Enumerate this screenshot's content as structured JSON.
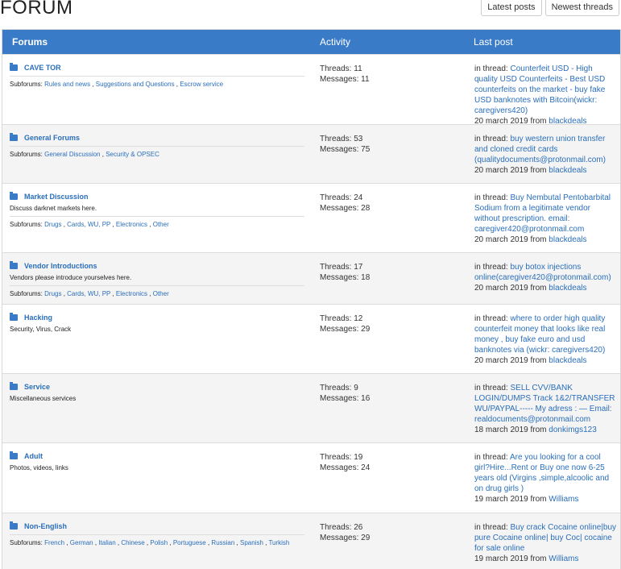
{
  "page_title": "FORUM",
  "top_buttons": {
    "latest_posts": "Latest posts",
    "newest_threads": "Newest threads"
  },
  "table_header": {
    "forums": "Forums",
    "activity": "Activity",
    "last_post": "Last post"
  },
  "labels": {
    "subforums_prefix": "Subforums:",
    "threads_prefix": "Threads:",
    "messages_prefix": "Messages:",
    "in_thread_prefix": "in thread:",
    "from_word": "from"
  },
  "colors": {
    "header_bg": "#3a7bc8",
    "link": "#2a6ebb"
  },
  "forums": [
    {
      "name": "CAVE TOR",
      "description": "",
      "subforums": [
        "Rules and news",
        "Suggestions and Questions",
        "Escrow service"
      ],
      "threads": "11",
      "messages": "11",
      "last_thread": "Counterfeit USD - High quality USD Counterfeits - Best USD counterfeits on the market - buy fake USD banknotes with Bitcoin(wickr: caregivers420)",
      "last_date": "20 march 2019",
      "last_user": "blackdeals"
    },
    {
      "name": "General Forums",
      "description": "",
      "subforums": [
        "General Discussion",
        "Security & OPSEC"
      ],
      "threads": "53",
      "messages": "75",
      "last_thread": "buy western union transfer and cloned credit cards (qualitydocuments@protonmail.com)",
      "last_date": "20 march 2019",
      "last_user": "blackdeals"
    },
    {
      "name": "Market Discussion",
      "description": "Discuss darknet markets here.",
      "subforums": [
        "Drugs",
        "Cards, WU, PP",
        "Electronics",
        "Other"
      ],
      "threads": "24",
      "messages": "28",
      "last_thread": "Buy Nembutal Pentobarbital Sodium from a legitimate vendor without prescription. email: caregiver420@protonmail.com",
      "last_date": "20 march 2019",
      "last_user": "blackdeals"
    },
    {
      "name": "Vendor Introductions",
      "description": "Vendors please introduce yourselves here.",
      "subforums": [
        "Drugs",
        "Cards, WU, PP",
        "Electronics",
        "Other"
      ],
      "threads": "17",
      "messages": "18",
      "last_thread": "buy botox injections online(caregiver420@protonmail.com)",
      "last_date": "20 march 2019",
      "last_user": "blackdeals"
    },
    {
      "name": "Hacking",
      "description": "Security, Virus, Crack",
      "subforums": [],
      "threads": "12",
      "messages": "29",
      "last_thread": "where to order high quality counterfeit money that looks like real money , buy fake euro and usd banknotes via (wickr: caregivers420)",
      "last_date": "20 march 2019",
      "last_user": "blackdeals"
    },
    {
      "name": "Service",
      "description": "Miscellaneous services",
      "subforums": [],
      "threads": "9",
      "messages": "16",
      "last_thread": "SELL CVV/BANK LOGIN/DUMPS Track 1&2/TRANSFER WU/PAYPAL----- My adress : — Email: realdocuments@protonmail.com",
      "last_date": "18 march 2019",
      "last_user": "donkimgs123"
    },
    {
      "name": "Adult",
      "description": "Photos, videos, links",
      "subforums": [],
      "threads": "19",
      "messages": "24",
      "last_thread": "Are you looking for a cool girl?Hire...Rent or Buy one now 6-25 years old (Virgins ,simple,alcoolic and on drug girls )",
      "last_date": "19 march 2019",
      "last_user": "Williams"
    },
    {
      "name": "Non-English",
      "description": "",
      "subforums": [
        "French",
        "German",
        "Italian",
        "Chinese",
        "Polish",
        "Portuguese",
        "Russian",
        "Spanish",
        "Turkish"
      ],
      "threads": "26",
      "messages": "29",
      "last_thread": "Buy crack Cocaine online|buy pure Cocaine online| buy Coc| cocaine for sale online",
      "last_date": "19 march 2019",
      "last_user": "Williams"
    }
  ]
}
